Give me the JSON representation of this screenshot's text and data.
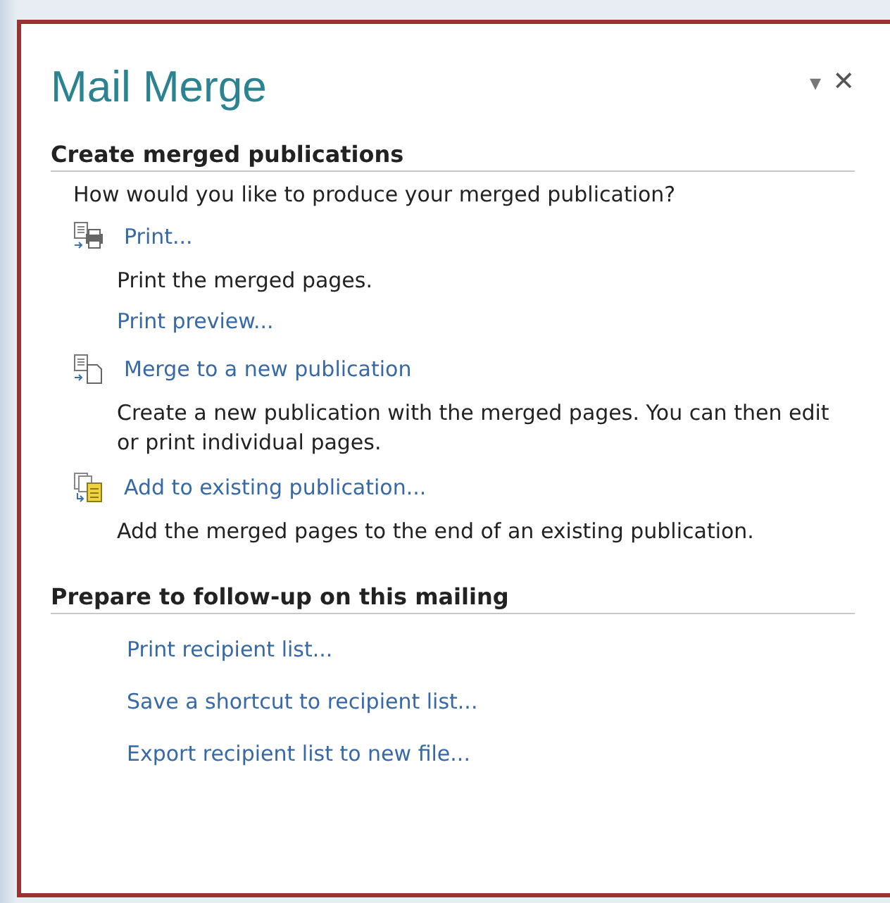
{
  "pane": {
    "title": "Mail Merge",
    "dropdown_glyph": "▾",
    "close_glyph": "✕"
  },
  "sections": [
    {
      "heading": "Create merged publications",
      "intro": "How would you like to produce your merged publication?",
      "actions": [
        {
          "label": "Print...",
          "description": "Print the merged pages.",
          "sublink": "Print preview..."
        },
        {
          "label": "Merge to a new publication",
          "description": "Create a new publication with the merged pages. You can then edit or print individual pages."
        },
        {
          "label": "Add to existing publication...",
          "description": "Add the merged pages to the end of an existing publication."
        }
      ]
    },
    {
      "heading": "Prepare to follow-up on this mailing",
      "links": [
        "Print recipient list...",
        "Save a shortcut to recipient list...",
        "Export recipient list to new file..."
      ]
    }
  ]
}
